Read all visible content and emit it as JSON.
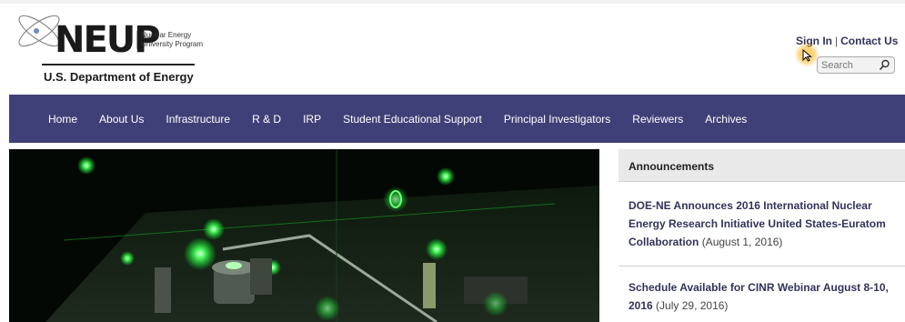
{
  "logo": {
    "wordmark": "NEUP",
    "subtitle_line1": "Nuclear Energy",
    "subtitle_line2": "University Program",
    "agency": "U.S. Department of Energy",
    "icon": "atom-icon"
  },
  "utility": {
    "sign_in": "Sign In",
    "separator": "|",
    "contact": "Contact Us"
  },
  "search": {
    "placeholder": "Search",
    "icon": "search-icon"
  },
  "nav": {
    "items": [
      {
        "label": "Home"
      },
      {
        "label": "About Us"
      },
      {
        "label": "Infrastructure"
      },
      {
        "label": "R & D"
      },
      {
        "label": "IRP"
      },
      {
        "label": "Student Educational Support"
      },
      {
        "label": "Principal Investigators"
      },
      {
        "label": "Reviewers"
      },
      {
        "label": "Archives"
      }
    ]
  },
  "announcements": {
    "title": "Announcements",
    "items": [
      {
        "headline": "DOE-NE Announces 2016 International Nuclear Energy Research Initiative United States-Euratom Collaboration",
        "date": "(August 1, 2016)"
      },
      {
        "headline": "Schedule Available for CINR Webinar August 8-10, 2016",
        "date": "(July 29, 2016)"
      }
    ]
  },
  "colors": {
    "nav_bg": "#404078",
    "link": "#33335b",
    "laser": "#33ff55"
  }
}
